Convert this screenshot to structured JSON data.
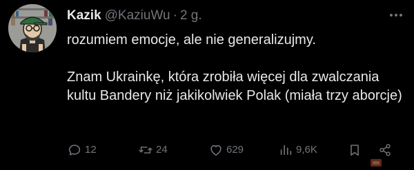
{
  "tweet": {
    "author": {
      "display_name": "Kazik",
      "handle": "@KaziuWu",
      "separator": "·",
      "time": "2 g."
    },
    "text_paragraphs": [
      "rozumiem emocje, ale nie generalizujmy.",
      "Znam Ukrainkę, która zrobiła więcej dla zwalczania kultu Bandery niż jakikolwiek Polak (miała trzy aborcje)"
    ],
    "actions": {
      "replies": "12",
      "reposts": "24",
      "likes": "629",
      "views": "9,6K"
    }
  },
  "colors": {
    "background": "#000000",
    "text": "#e7e9ea",
    "muted": "#71767b"
  },
  "icons": {
    "avatar": "cartoon-avatar",
    "more": "more-dots-icon",
    "reply": "reply-icon",
    "repost": "repost-icon",
    "like": "heart-icon",
    "views": "views-chart-icon",
    "bookmark": "bookmark-icon",
    "share": "share-icon"
  }
}
